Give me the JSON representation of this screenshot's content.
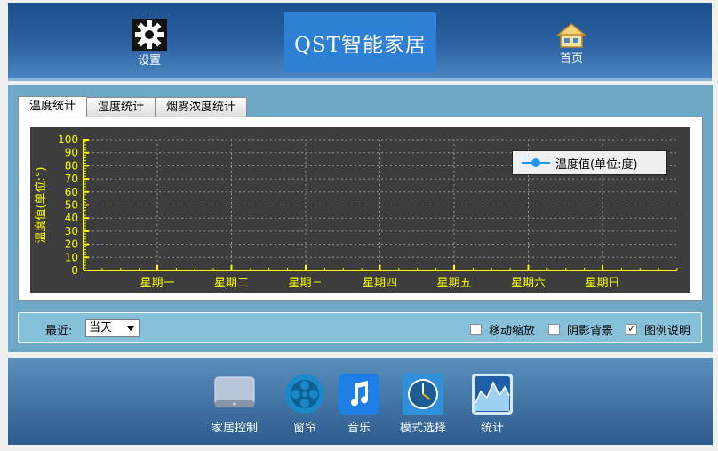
{
  "header": {
    "settings_label": "设置",
    "logo_text": "QST智能家居",
    "home_label": "首页"
  },
  "tabs": [
    {
      "label": "温度统计",
      "active": true
    },
    {
      "label": "湿度统计",
      "active": false
    },
    {
      "label": "烟雾浓度统计",
      "active": false
    }
  ],
  "chart_data": {
    "type": "line",
    "categories": [
      "星期一",
      "星期二",
      "星期三",
      "星期四",
      "星期五",
      "星期六",
      "星期日"
    ],
    "series": [
      {
        "name": "温度值(单位:度)",
        "values": []
      }
    ],
    "ylabel": "温度值(单位:°)",
    "ylim": [
      0,
      100
    ],
    "yticks": [
      0,
      10,
      20,
      30,
      40,
      50,
      60,
      70,
      80,
      90,
      100
    ],
    "grid": true,
    "legend_position": "top-right",
    "colors": {
      "background": "#3d3d3d",
      "axis": "#ffff00",
      "series": "#2196f3",
      "grid": "#9a9a9a"
    }
  },
  "controls": {
    "range_label": "最近:",
    "range_value": "当天",
    "options": [
      {
        "label": "移动缩放",
        "checked": false
      },
      {
        "label": "阴影背景",
        "checked": false
      },
      {
        "label": "图例说明",
        "checked": true
      }
    ]
  },
  "dock": [
    {
      "label": "家居控制",
      "icon": "monitor-icon"
    },
    {
      "label": "窗帘",
      "icon": "film-reel-icon"
    },
    {
      "label": "音乐",
      "icon": "music-note-icon"
    },
    {
      "label": "模式选择",
      "icon": "clock-icon"
    },
    {
      "label": "统计",
      "icon": "chart-icon"
    }
  ]
}
